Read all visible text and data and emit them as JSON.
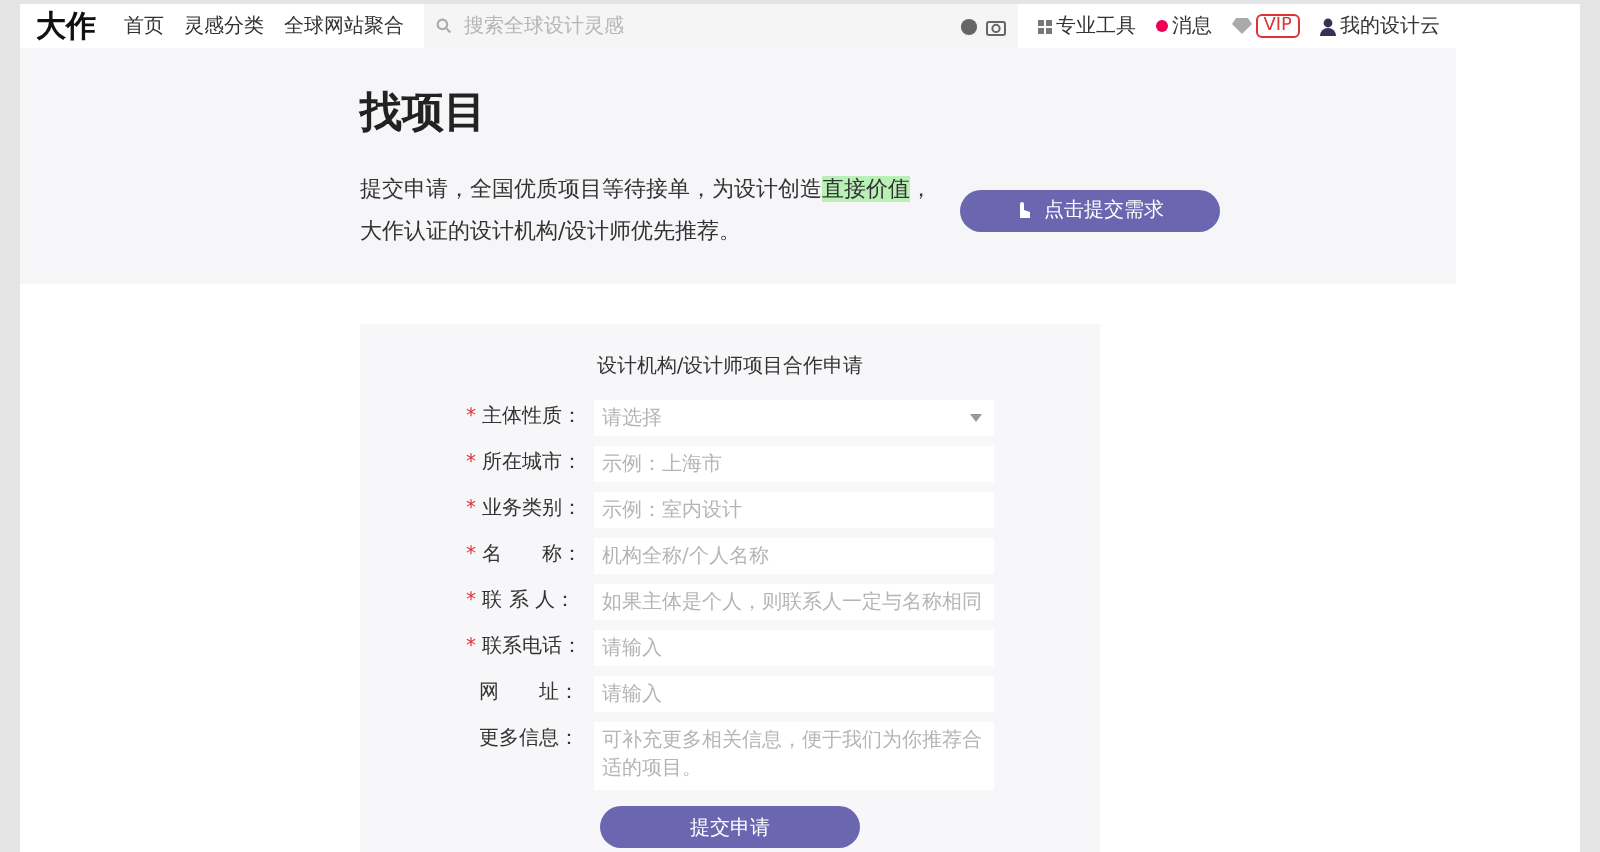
{
  "header": {
    "logo": "大作",
    "nav": [
      "首页",
      "灵感分类",
      "全球网站聚合"
    ],
    "search": {
      "placeholder": "搜索全球设计灵感"
    },
    "tools": "专业工具",
    "messages": "消息",
    "vip": "VIP",
    "account": "我的设计云"
  },
  "hero": {
    "title": "找项目",
    "intro": [
      {
        "text": "提交申请，全国优质项目等待接单，为设计创造",
        "highlighted": false
      },
      {
        "text": "直接价值",
        "highlighted": true
      },
      {
        "text": "，",
        "highlighted": false
      }
    ],
    "intro_line2": "大作认证的设计机构/设计师优先推荐。",
    "button": "点击提交需求"
  },
  "form": {
    "required_mark": "*",
    "title": "设计机构/设计师项目合作申请",
    "fields": [
      {
        "label": "主体性质：",
        "required": true,
        "kind": "select",
        "placeholder": "请选择"
      },
      {
        "label": "所在城市：",
        "required": true,
        "kind": "input",
        "placeholder": "示例：上海市"
      },
      {
        "label": "业务类别：",
        "required": true,
        "kind": "input",
        "placeholder": "示例：室内设计"
      },
      {
        "label": "名　　称：",
        "required": true,
        "kind": "input",
        "placeholder": "机构全称/个人名称"
      },
      {
        "label": "联 系 人：",
        "required": true,
        "kind": "input",
        "placeholder": "如果主体是个人，则联系人一定与名称相同"
      },
      {
        "label": "联系电话：",
        "required": true,
        "kind": "input",
        "placeholder": "请输入"
      },
      {
        "label": "网　　址：",
        "required": false,
        "kind": "input",
        "placeholder": "请输入"
      },
      {
        "label": "更多信息：",
        "required": false,
        "kind": "textarea",
        "placeholder": "可补充更多相关信息，便于我们为你推荐合适的项目。"
      }
    ],
    "submit": "提交申请"
  }
}
